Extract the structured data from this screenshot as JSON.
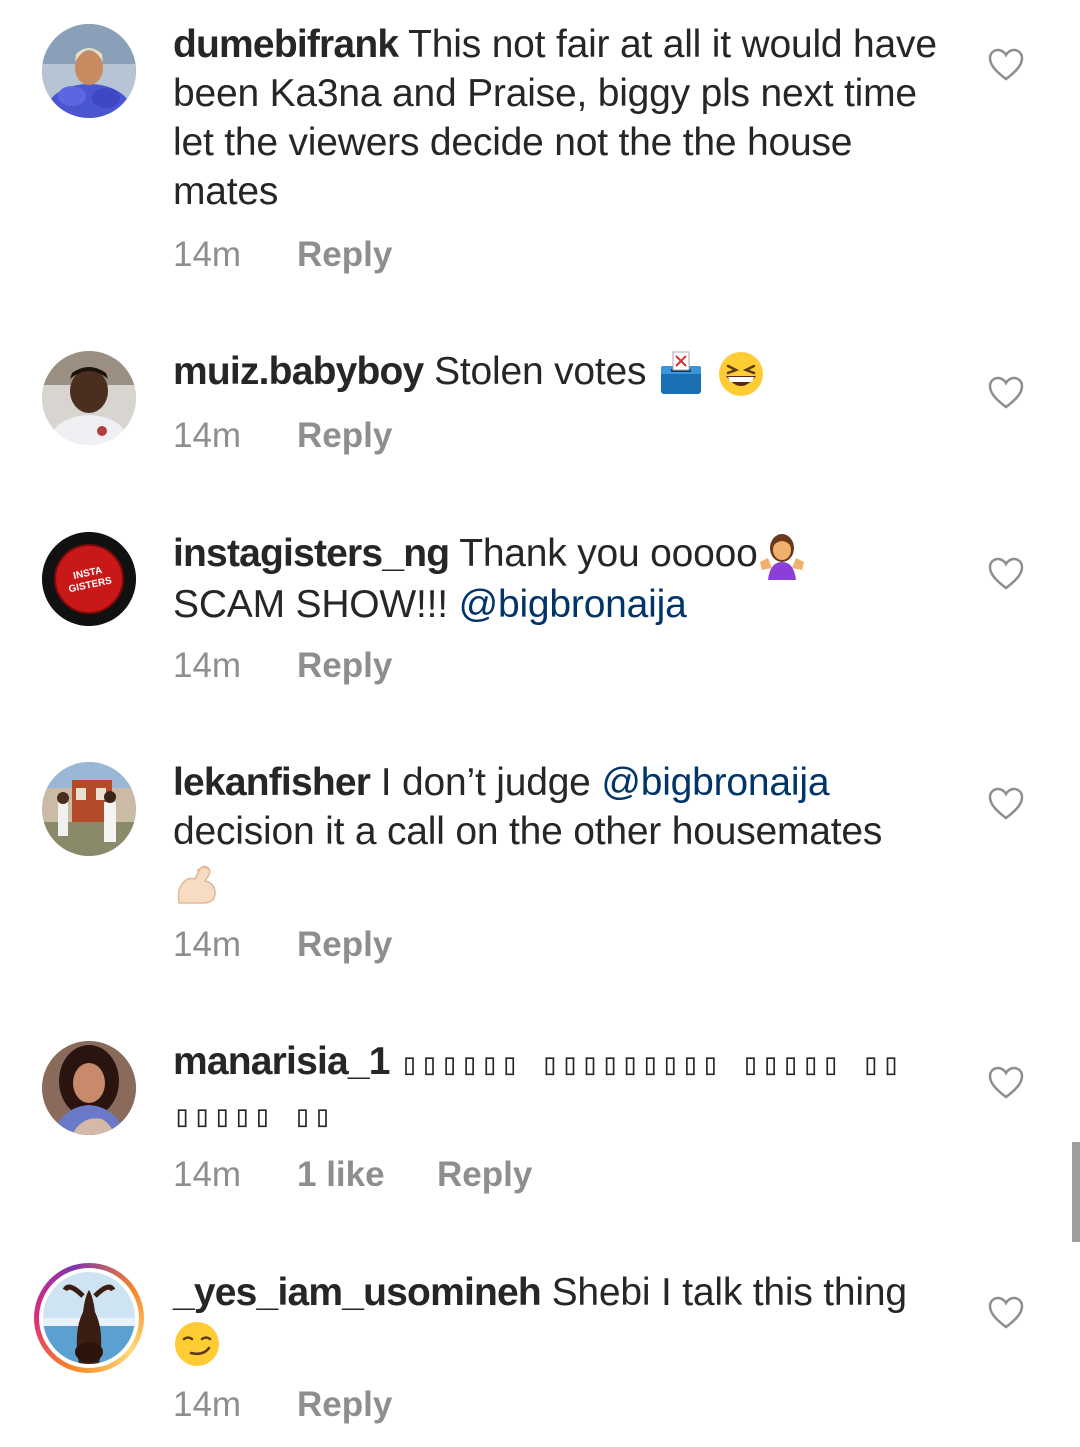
{
  "comments": [
    {
      "username": "dumebifrank",
      "text": " This not fair at all it would have been Ka3na and Praise, biggy pls next time let the viewers decide not the the house mates",
      "time": "14m",
      "reply": "Reply",
      "avatar_icon": "profile-photo"
    },
    {
      "username": "muiz.babyboy",
      "text": " Stolen votes ",
      "emojis": [
        "ballot-box-emoji",
        "grinning-squinting-face-emoji"
      ],
      "time": "14m",
      "reply": "Reply",
      "avatar_icon": "profile-photo"
    },
    {
      "username": "instagisters_ng",
      "text": " Thank you ooooo",
      "emoji": "woman-shrugging-emoji",
      "text2": "SCAM SHOW!!! ",
      "mention": "@bigbronaija",
      "time": "14m",
      "reply": "Reply",
      "avatar_logo": {
        "line1": "INSTA",
        "line2": "GISTERS"
      }
    },
    {
      "username": "lekanfisher",
      "text": " I don’t judge ",
      "mention": "@bigbronaija",
      "text2": "decision it a call on the other housemates",
      "emoji": "flexed-biceps-emoji",
      "time": "14m",
      "reply": "Reply",
      "avatar_icon": "profile-photo"
    },
    {
      "username": "manarisia_1",
      "tofu_line1": "▯▯▯▯▯▯ ▯▯▯▯▯▯▯▯▯ ▯▯▯▯▯ ▯▯",
      "tofu_line2": "▯▯▯▯▯ ▯▯",
      "time": "14m",
      "likes": "1 like",
      "reply": "Reply",
      "avatar_icon": "profile-photo"
    },
    {
      "username": "_yes_iam_usomineh",
      "text": " Shebi I talk this thing",
      "emoji": "smirking-face-emoji",
      "time": "14m",
      "reply": "Reply",
      "avatar_icon": "profile-photo-with-story-ring"
    }
  ],
  "colors": {
    "text": "#262626",
    "meta": "#8e8e8e",
    "mention": "#003569"
  }
}
